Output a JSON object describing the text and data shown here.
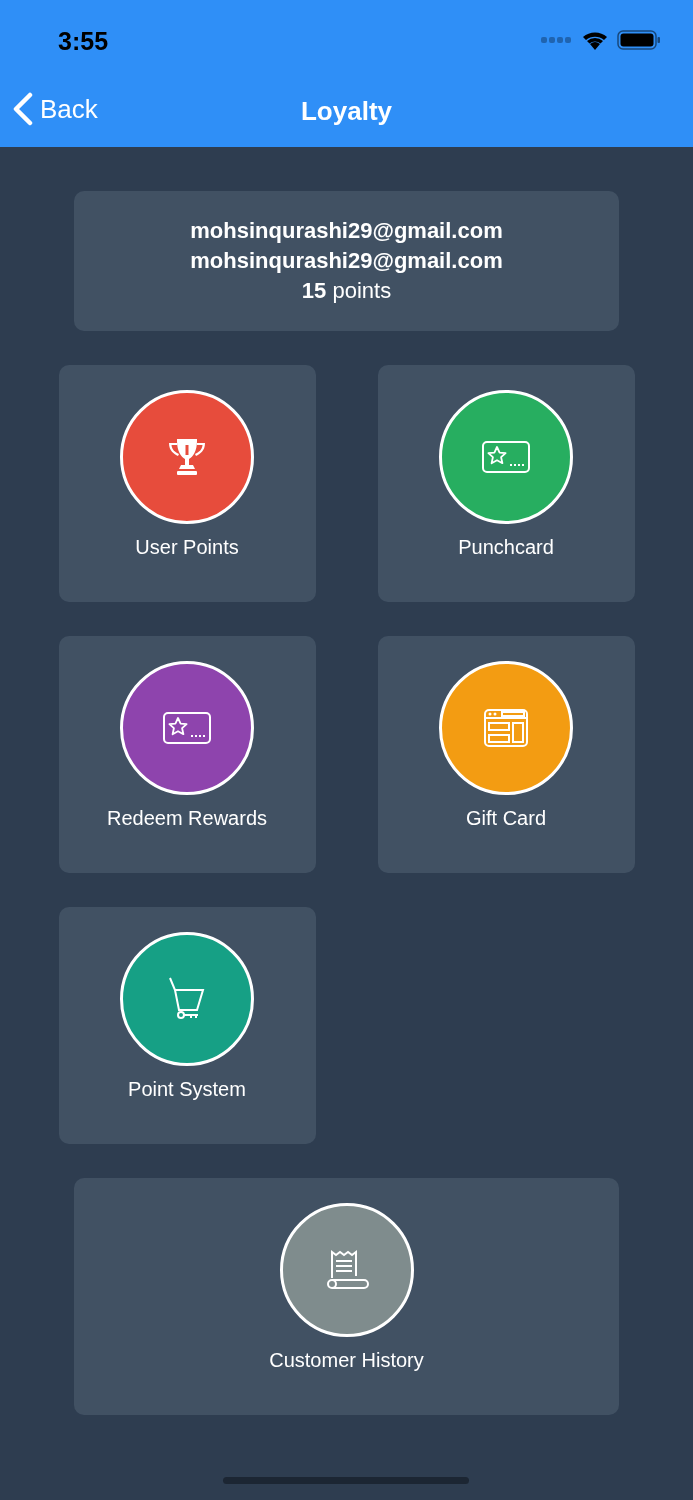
{
  "status_bar": {
    "time": "3:55"
  },
  "nav_bar": {
    "back": "Back",
    "title": "Loyalty"
  },
  "account": {
    "lines": [
      "mohsinqurashi29@gmail.com",
      "mohsinqurashi29@gmail.com"
    ],
    "points": "**15** points"
  },
  "tiles": [
    {
      "label": "User Points",
      "kind": "half",
      "color": "#e74c3c"
    },
    {
      "label": "Punchcard",
      "kind": "half",
      "color": "#27ae60"
    },
    {
      "label": "Redeem Rewards",
      "kind": "half",
      "color": "#8e44ad"
    },
    {
      "label": "Gift Card",
      "kind": "half",
      "color": "#f39c12"
    },
    {
      "label": "Point System",
      "kind": "half",
      "color": "#16a085"
    },
    {
      "label": "Customer History",
      "kind": "wide",
      "color": "#7f8c8d"
    }
  ]
}
